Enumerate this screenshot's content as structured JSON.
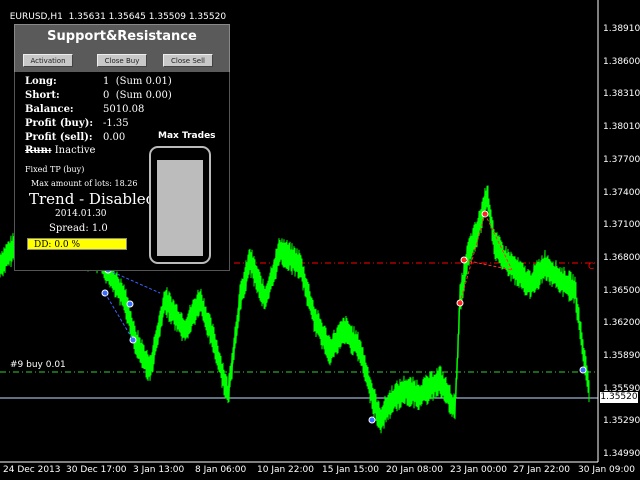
{
  "chart_header": {
    "symbol": "EURUSD,H1",
    "ohlc": "1.35631 1.35645 1.35509 1.35520"
  },
  "panel": {
    "title": "Support&Resistance",
    "buttons": {
      "activation": "Activation",
      "close_buy": "Close Buy",
      "close_sell": "Close Sell"
    }
  },
  "info": {
    "long_label": "Long:",
    "long_value": "1  (Sum 0.01)",
    "short_label": "Short:",
    "short_value": "0  (Sum 0.00)",
    "balance_label": "Balance:",
    "balance_value": "5010.08",
    "profit_buy_label": "Profit (buy):",
    "profit_buy_value": "-1.35",
    "profit_sell_label": "Profit (sell):",
    "profit_sell_value": "0.00",
    "run_label": "Run:",
    "run_value": "Inactive",
    "fixed_tp": "Fixed TP (buy)",
    "max_lots": "Max amount of lots: 18.26",
    "trend": "Trend - Disabled",
    "date": "2014.01.30",
    "spread": "Spread: 1.0",
    "dd": "DD: 0.0 %"
  },
  "max_trades": {
    "label": "Max Trades",
    "fill": 1.0
  },
  "price_axis": {
    "ticks": [
      "1.38910",
      "1.38600",
      "1.38310",
      "1.38010",
      "1.37700",
      "1.37400",
      "1.37100",
      "1.36800",
      "1.36500",
      "1.36200",
      "1.35890",
      "1.35590",
      "1.35290",
      "1.34990"
    ],
    "current": "1.35520"
  },
  "time_axis": {
    "labels": [
      "24 Dec 2013",
      "30 Dec 17:00",
      "3 Jan 13:00",
      "8 Jan 06:00",
      "10 Jan 22:00",
      "15 Jan 15:00",
      "20 Jan 08:00",
      "23 Jan 00:00",
      "27 Jan 22:00",
      "30 Jan 09:00"
    ]
  },
  "order_label": "#9 buy 0.01",
  "colors": {
    "price_line": "#00ff00",
    "resistance": "#ff0000",
    "buy_level": "#33cc33",
    "background": "#000000"
  }
}
